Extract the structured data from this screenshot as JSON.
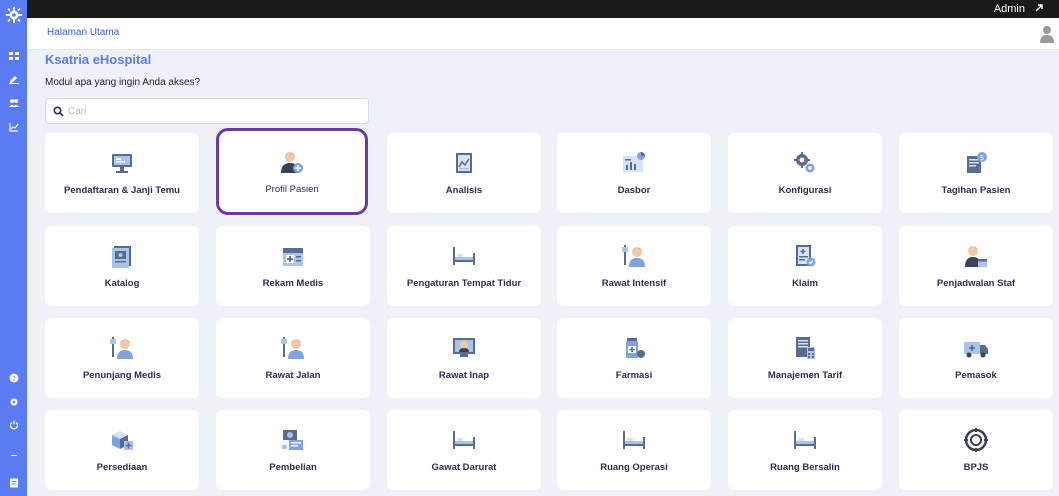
{
  "topbar": {
    "user": "Admin"
  },
  "header": {
    "breadcrumb": "Halaman Utama"
  },
  "main": {
    "title": "Ksatria eHospital",
    "prompt": "Modul apa yang ingin Anda akses?",
    "search_placeholder": "Cari"
  },
  "modules": [
    {
      "label": "Pendaftaran & Janji Temu",
      "icon": "monitor-icon"
    },
    {
      "label": "Profil Pasien",
      "icon": "patient-profile-icon"
    },
    {
      "label": "Analisis",
      "icon": "analysis-icon"
    },
    {
      "label": "Dasbor",
      "icon": "dashboard-icon"
    },
    {
      "label": "Konfigurasi",
      "icon": "gears-icon"
    },
    {
      "label": "Tagihan Pasien",
      "icon": "bill-icon"
    },
    {
      "label": "Katalog",
      "icon": "catalog-icon"
    },
    {
      "label": "Rekam Medis",
      "icon": "medical-record-icon"
    },
    {
      "label": "Pengaturan Tempat Tidur",
      "icon": "bed-icon"
    },
    {
      "label": "Rawat Intensif",
      "icon": "intensive-care-icon"
    },
    {
      "label": "Klaim",
      "icon": "claim-icon"
    },
    {
      "label": "Penjadwalan Staf",
      "icon": "staff-icon"
    },
    {
      "label": "Penunjang Medis",
      "icon": "medical-support-icon"
    },
    {
      "label": "Rawat Jalan",
      "icon": "outpatient-icon"
    },
    {
      "label": "Rawat Inap",
      "icon": "inpatient-icon"
    },
    {
      "label": "Farmasi",
      "icon": "pharmacy-icon"
    },
    {
      "label": "Manajemen Tarif",
      "icon": "tariff-icon"
    },
    {
      "label": "Pemasok",
      "icon": "ambulance-icon"
    },
    {
      "label": "Persediaan",
      "icon": "inventory-icon"
    },
    {
      "label": "Pembelian",
      "icon": "purchase-icon"
    },
    {
      "label": "Gawat Darurat",
      "icon": "emergency-bed-icon"
    },
    {
      "label": "Ruang Operasi",
      "icon": "operation-bed-icon"
    },
    {
      "label": "Ruang Bersalin",
      "icon": "delivery-bed-icon"
    },
    {
      "label": "BPJS",
      "icon": "bpjs-icon"
    }
  ],
  "colors": {
    "sidebar": "#5b7cf0",
    "highlight": "#6b3aa0",
    "title": "#5b7cf0"
  }
}
